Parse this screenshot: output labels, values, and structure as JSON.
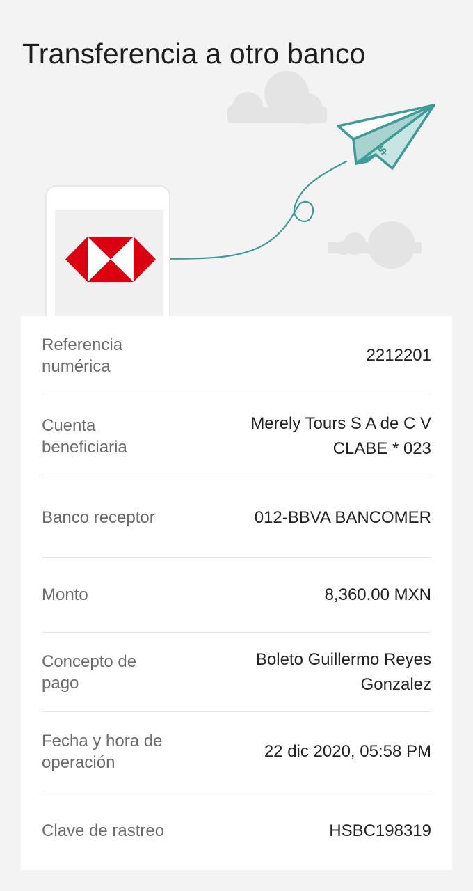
{
  "header": {
    "title": "Transferencia a otro banco"
  },
  "illustration": {
    "icons": [
      "cloud-icon",
      "paper-plane-icon",
      "dollar-sign-icon",
      "phone-icon",
      "hsbc-logo"
    ],
    "colors": {
      "plane": "#3f9b98",
      "plane_fill": "#a8d3cf",
      "cloud": "#e6e6e6",
      "hsbc_red": "#db0011"
    }
  },
  "details": {
    "reference": {
      "label": "Referencia numérica",
      "value": "2212201"
    },
    "beneficiary": {
      "label": "Cuenta beneficiaria",
      "value_line1": "Merely Tours S A de C V",
      "value_line2": "CLABE * 023"
    },
    "bank": {
      "label": "Banco receptor",
      "value": "012-BBVA BANCOMER"
    },
    "amount": {
      "label": "Monto",
      "value": "8,360.00 MXN"
    },
    "concept": {
      "label": "Concepto de pago",
      "value_line1": "Boleto Guillermo Reyes",
      "value_line2": "Gonzalez"
    },
    "datetime": {
      "label": "Fecha y hora de operación",
      "value": "22 dic 2020, 05:58 PM"
    },
    "tracking": {
      "label": "Clave de rastreo",
      "value": "HSBC198319"
    }
  }
}
